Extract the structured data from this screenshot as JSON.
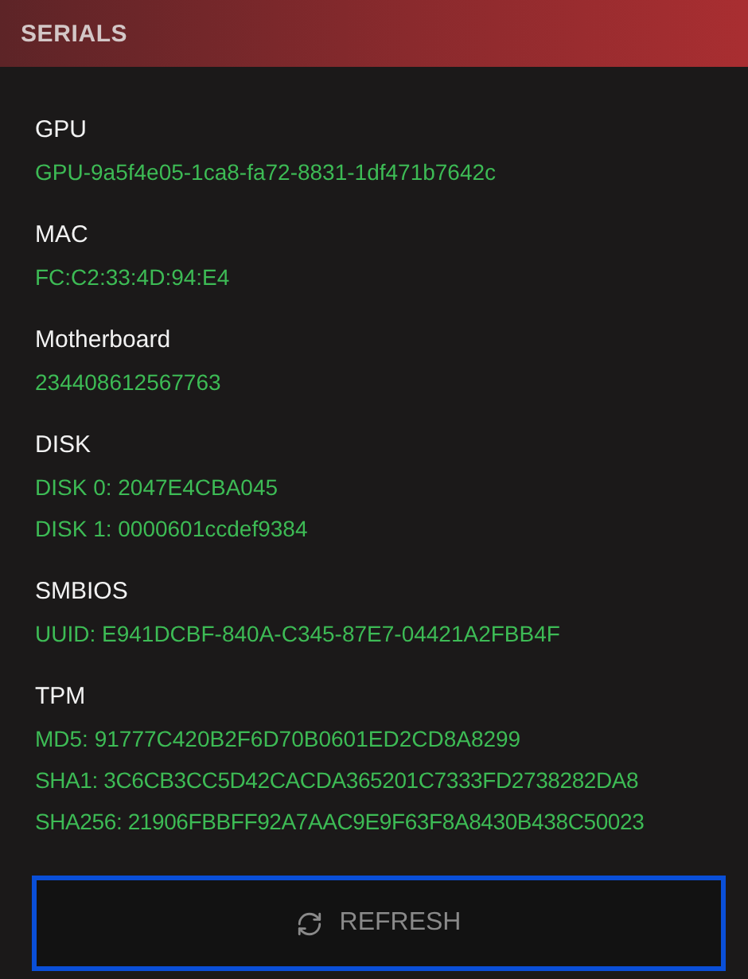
{
  "header": {
    "title": "SERIALS"
  },
  "sections": [
    {
      "label": "GPU",
      "values": [
        "GPU-9a5f4e05-1ca8-fa72-8831-1df471b7642c"
      ]
    },
    {
      "label": "MAC",
      "values": [
        "FC:C2:33:4D:94:E4"
      ]
    },
    {
      "label": "Motherboard",
      "values": [
        "234408612567763"
      ]
    },
    {
      "label": "DISK",
      "values": [
        "DISK 0: 2047E4CBA045",
        "DISK 1: 0000601ccdef9384"
      ]
    },
    {
      "label": "SMBIOS",
      "values": [
        "UUID: E941DCBF-840A-C345-87E7-04421A2FBB4F"
      ]
    },
    {
      "label": "TPM",
      "values": [
        "MD5: 91777C420B2F6D70B0601ED2CD8A8299",
        "SHA1: 3C6CB3CC5D42CACDA365201C7333FD2738282DA8",
        "SHA256: 21906FBBFF92A7AAC9E9F63F8A8430B438C50023"
      ]
    }
  ],
  "refresh_button": {
    "label": "REFRESH",
    "focused": true
  }
}
